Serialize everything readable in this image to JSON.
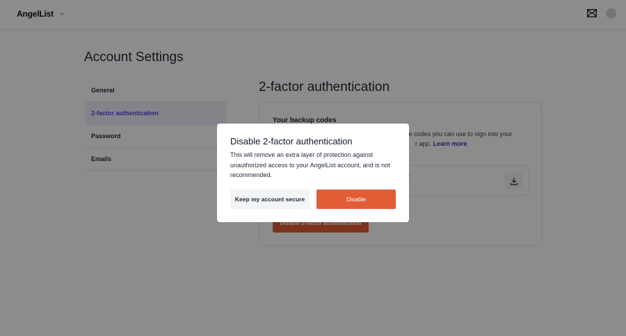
{
  "header": {
    "brand": "AngelList",
    "icons": {
      "brand_menu": "chevron-down-icon",
      "inbox": "mail-icon",
      "profile": "avatar"
    }
  },
  "page": {
    "title": "Account Settings"
  },
  "sidebar": {
    "active_index": 1,
    "items": [
      {
        "label": "General"
      },
      {
        "label": "2-factor authentication"
      },
      {
        "label": "Password"
      },
      {
        "label": "Emails"
      }
    ]
  },
  "main": {
    "section_title": "2-factor authentication",
    "card": {
      "heading": "Your backup codes",
      "description_visible_line1": "me codes you can use to sign into your",
      "description_visible_line2": "r app.",
      "learn_more": "Learn more",
      "download_label_visible": "t",
      "download_icon": "download-icon",
      "disable_button": "Disable 2-factor authentication"
    }
  },
  "modal": {
    "title": "Disable 2-factor authentication",
    "body": "This will remove an extra layer of protection against unauthorized access to your AngelList account, and is not recommended.",
    "keep_button": "Keep my account secure",
    "disable_button": "Disable"
  },
  "colors": {
    "accent": "#e25c36",
    "active_nav_bg": "#eef0fb",
    "active_nav_text": "#4f46e5",
    "link": "#3730a3",
    "overlay": "rgba(0,0,0,0.45)"
  }
}
